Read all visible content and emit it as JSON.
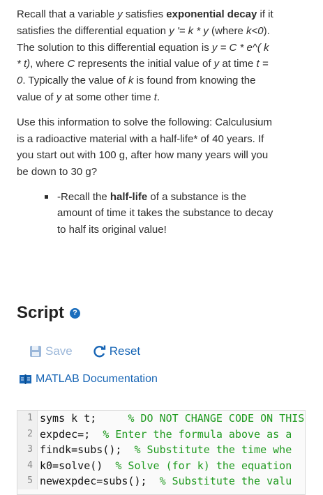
{
  "problem": {
    "p1": {
      "t1": "Recall that a variable ",
      "y1": "y",
      "t2": " satisfies ",
      "bold": "exponential decay",
      "t3": " if it satisfies the differential equation ",
      "eq1": "y '= k * y",
      "t4": " (where ",
      "kcond": "k<0",
      "t5": "). The solution to this differential equation is ",
      "eq2": "y = C * e^( k * t)",
      "t6": ", where ",
      "C": "C",
      "t7": " represents the initial value of ",
      "y2": "y",
      "t8": " at time ",
      "t0": "t = 0",
      "t9": ". Typically the value of ",
      "k2": "k",
      "t10": " is found from knowing the value of ",
      "y3": "y",
      "t11": " at some other time ",
      "t_end": "t",
      "t12": "."
    },
    "p2": "Use this information to solve the following: Calculusium is a radioactive material with a half-life* of 40 years. If you start out with 100 g, after how many years will you be down to 30 g?",
    "bullet": {
      "pre": "-Recall the ",
      "bold": "half-life",
      "post": " of a substance is the amount of time it takes the substance to decay to half its original value!"
    }
  },
  "script": {
    "title": "Script",
    "help_icon": "question-circle-icon",
    "save_label": "Save",
    "reset_label": "Reset",
    "doc_label": "MATLAB Documentation"
  },
  "colors": {
    "link": "#1765b5",
    "save_disabled": "#9bb7d9",
    "comment": "#1f9a1f"
  },
  "code_lines": [
    {
      "n": "1",
      "code": "syms k t;     ",
      "comment": "% DO NOT CHANGE CODE ON THIS"
    },
    {
      "n": "2",
      "code": "expdec=;  ",
      "comment": "% Enter the formula above as a"
    },
    {
      "n": "3",
      "code": "findk=subs();  ",
      "comment": "% Substitute the time whe"
    },
    {
      "n": "4",
      "code": "k0=solve()  ",
      "comment": "% Solve (for k) the equation"
    },
    {
      "n": "5",
      "code": "newexpdec=subs();  ",
      "comment": "% Substitute the valu"
    }
  ]
}
